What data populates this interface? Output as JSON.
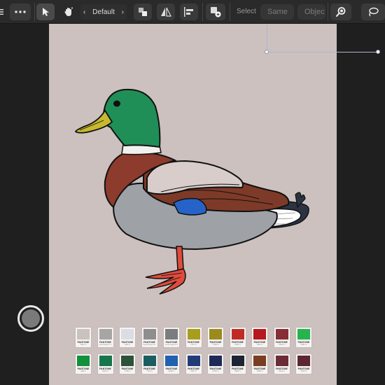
{
  "toolbar": {
    "preset_label": "Default",
    "select_label": "Select",
    "same_label": "Same",
    "object_label": "Objec"
  },
  "swatches": {
    "row1": [
      {
        "label": "PANTONE",
        "code": "7527 C",
        "color": "#c9c2bd"
      },
      {
        "label": "PANTONE",
        "code": "Cool Gray 7 C",
        "color": "#a7a6a4"
      },
      {
        "label": "PANTONE",
        "code": "649 C",
        "color": "#dcdde4"
      },
      {
        "label": "PANTONE",
        "code": "Cool Gray 8 C",
        "color": "#8e8e8e"
      },
      {
        "label": "PANTONE",
        "code": "Cool Gray 9 C",
        "color": "#7b7c7e"
      },
      {
        "label": "PANTONE",
        "code": "7767 C",
        "color": "#a89d1c"
      },
      {
        "label": "PANTONE",
        "code": "7768 C",
        "color": "#9c8a1e"
      },
      {
        "label": "PANTONE",
        "code": "7620 C",
        "color": "#c02b25"
      },
      {
        "label": "PANTONE",
        "code": "7621 C",
        "color": "#b5191d"
      },
      {
        "label": "PANTONE",
        "code": "7624 C",
        "color": "#862d36"
      },
      {
        "label": "PANTONE",
        "code": "7481 C",
        "color": "#27b34d"
      }
    ],
    "row2": [
      {
        "label": "PANTONE",
        "code": "348 C",
        "color": "#12913c"
      },
      {
        "label": "PANTONE",
        "code": "3425 C",
        "color": "#17764a"
      },
      {
        "label": "PANTONE",
        "code": "7736 C",
        "color": "#2d523a"
      },
      {
        "label": "PANTONE",
        "code": "7715 C",
        "color": "#1b5e61"
      },
      {
        "label": "PANTONE",
        "code": "2935 C",
        "color": "#1f62b0"
      },
      {
        "label": "PANTONE",
        "code": "7687 C",
        "color": "#233c78"
      },
      {
        "label": "PANTONE",
        "code": "2766 C",
        "color": "#1e2956"
      },
      {
        "label": "PANTONE",
        "code": "5395 C",
        "color": "#1d2433"
      },
      {
        "label": "PANTONE",
        "code": "7586 C",
        "color": "#7a3e22"
      },
      {
        "label": "PANTONE",
        "code": "7644 C",
        "color": "#6a2d35"
      },
      {
        "label": "PANTONE",
        "code": "7645 C",
        "color": "#5e2630"
      }
    ]
  }
}
